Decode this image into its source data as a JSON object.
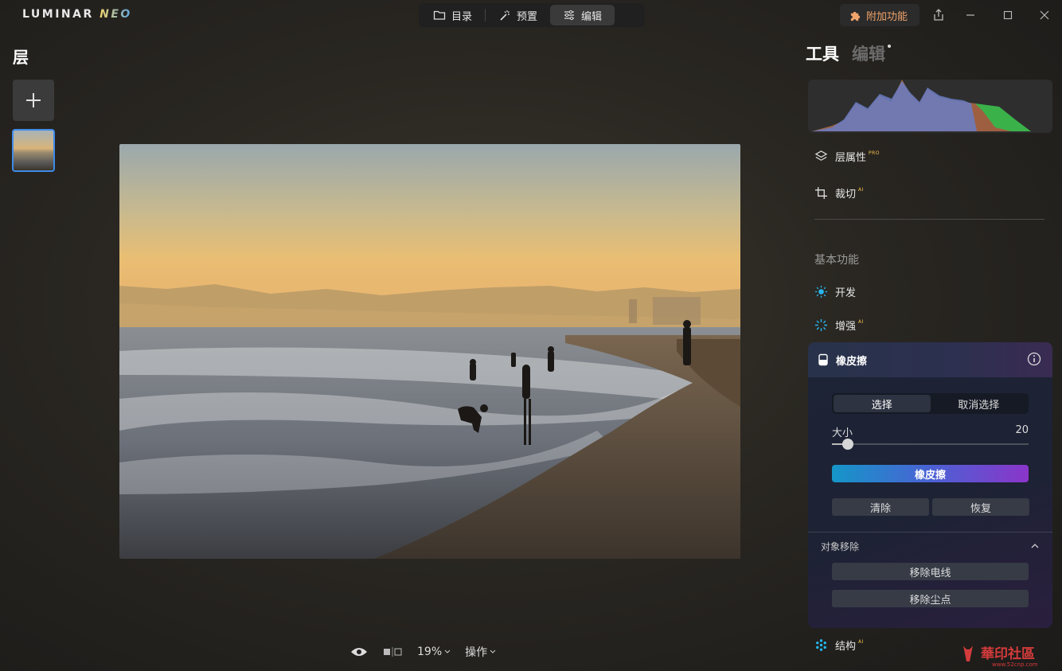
{
  "app": {
    "logo_main": "LUMINAR",
    "logo_sub": "NEO"
  },
  "modes": [
    {
      "label": "目录",
      "icon": "folder-icon",
      "active": false
    },
    {
      "label": "预置",
      "icon": "magic-wand-icon",
      "active": false
    },
    {
      "label": "编辑",
      "icon": "sliders-icon",
      "active": true
    }
  ],
  "header": {
    "addon_label": "附加功能"
  },
  "layers": {
    "title": "层"
  },
  "bottom": {
    "zoom": "19%",
    "actions_label": "操作"
  },
  "right": {
    "tab_tools": "工具",
    "tab_edits": "编辑",
    "layer_props": "层属性",
    "layer_props_badge": "PRO",
    "crop": "裁切",
    "crop_badge": "AI",
    "section_basic": "基本功能",
    "develop": "开发",
    "enhance": "增强",
    "enhance_badge": "AI",
    "structure": "结构",
    "structure_badge": "AI"
  },
  "eraser": {
    "title": "橡皮擦",
    "seg_select": "选择",
    "seg_deselect": "取消选择",
    "size_label": "大小",
    "size_value": "20",
    "size_fraction": 0.08,
    "erase_button": "橡皮擦",
    "clear_button": "清除",
    "restore_button": "恢复",
    "object_removal_title": "对象移除",
    "remove_powerlines": "移除电线",
    "remove_dust": "移除尘点"
  },
  "colors": {
    "accent_blue": "#3f8be8",
    "addon_orange": "#f0a36a",
    "gradient_start": "#1596c8",
    "gradient_end": "#8b35c9"
  }
}
